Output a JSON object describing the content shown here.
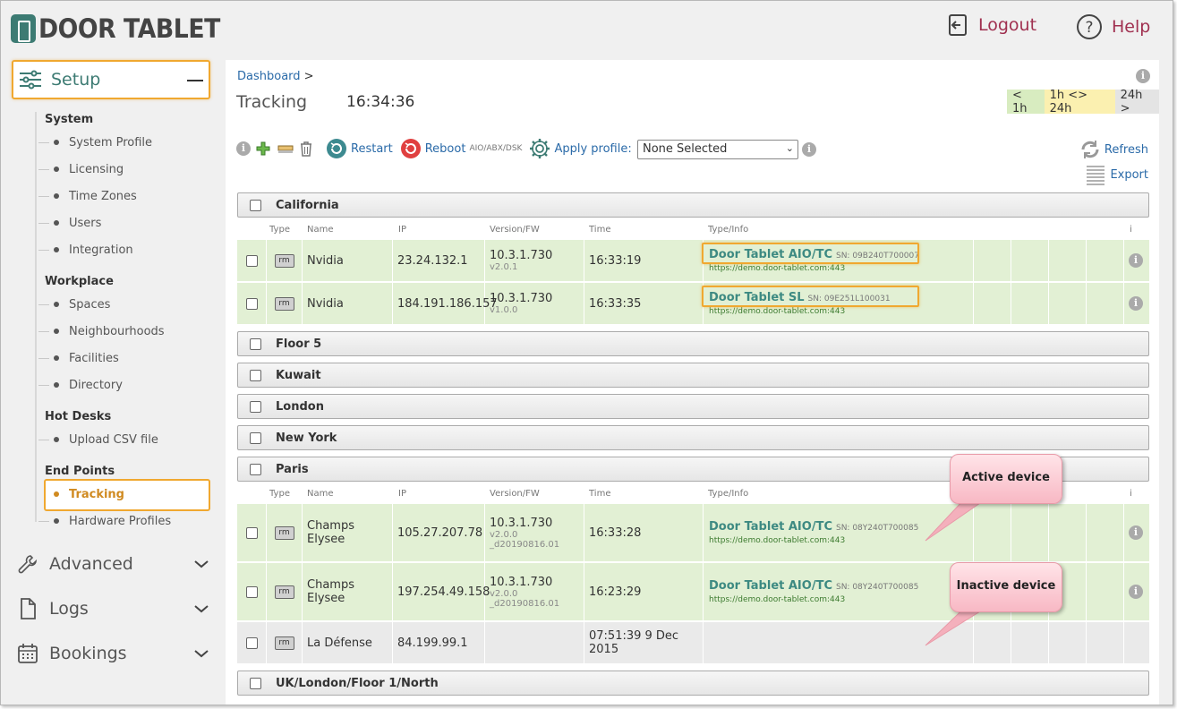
{
  "header": {
    "logo_text": "DOOR TABLET",
    "logout_label": "Logout",
    "help_label": "Help"
  },
  "sidebar": {
    "setup_label": "Setup",
    "sections": [
      {
        "title": "System",
        "items": [
          "System Profile",
          "Licensing",
          "Time Zones",
          "Users",
          "Integration"
        ]
      },
      {
        "title": "Workplace",
        "items": [
          "Spaces",
          "Neighbourhoods",
          "Facilities",
          "Directory"
        ]
      },
      {
        "title": "Hot Desks",
        "items": [
          "Upload CSV file"
        ]
      },
      {
        "title": "End Points",
        "items": [
          "Tracking",
          "Hardware Profiles"
        ]
      }
    ],
    "active_item": "Tracking",
    "collapsed": [
      {
        "label": "Advanced",
        "icon": "wrench-icon"
      },
      {
        "label": "Logs",
        "icon": "document-icon"
      },
      {
        "label": "Bookings",
        "icon": "calendar-icon"
      }
    ]
  },
  "main": {
    "breadcrumb": "Dashboard",
    "breadcrumb_sep": ">",
    "title": "Tracking",
    "clock": "16:34:36",
    "ranges": [
      {
        "label": "< 1h",
        "color": "#d8ecc0"
      },
      {
        "label": "1h <> 24h",
        "color": "#fbf0b0"
      },
      {
        "label": "24h >",
        "color": "#e4e4e4"
      }
    ],
    "toolbar": {
      "restart_label": "Restart",
      "reboot_label": "Reboot",
      "reboot_note": "AIO/ABX/DSK",
      "apply_profile_label": "Apply profile:",
      "profile_value": "None Selected",
      "refresh_label": "Refresh",
      "export_label": "Export"
    },
    "columns": [
      "Type",
      "Name",
      "IP",
      "Version/FW",
      "Time",
      "Type/Info",
      "i"
    ],
    "groups": [
      {
        "name": "California",
        "devices": [
          {
            "type": "rm",
            "name": "Nvidia",
            "ip": "23.24.132.1",
            "version": "10.3.1.730",
            "fw": "v2.0.1",
            "fw2": "",
            "time": "16:33:19",
            "device_type": "Door Tablet AIO/TC",
            "sn": "SN: 09B240T700007",
            "url": "https://demo.door-tablet.com:443",
            "status": "active"
          },
          {
            "type": "rm",
            "name": "Nvidia",
            "ip": "184.191.186.157",
            "version": "10.3.1.730",
            "fw": "v1.0.0",
            "fw2": "",
            "time": "16:33:35",
            "device_type": "Door Tablet SL",
            "sn": "SN: 09E251L100031",
            "url": "https://demo.door-tablet.com:443",
            "status": "active"
          }
        ]
      },
      {
        "name": "Floor 5",
        "devices": []
      },
      {
        "name": "Kuwait",
        "devices": []
      },
      {
        "name": "London",
        "devices": []
      },
      {
        "name": "New York",
        "devices": []
      },
      {
        "name": "Paris",
        "devices": [
          {
            "type": "rm",
            "name": "Champs Elysee",
            "ip": "105.27.207.78",
            "version": "10.3.1.730",
            "fw": "v2.0.0",
            "fw2": "_d20190816.01",
            "time": "16:33:28",
            "device_type": "Door Tablet AIO/TC",
            "sn": "SN: 08Y240T700085",
            "url": "https://demo.door-tablet.com:443",
            "status": "active"
          },
          {
            "type": "rm",
            "name": "Champs Elysee",
            "ip": "197.254.49.158",
            "version": "10.3.1.730",
            "fw": "v2.0.0",
            "fw2": "_d20190816.01",
            "time": "16:23:29",
            "device_type": "Door Tablet AIO/TC",
            "sn": "SN: 08Y240T700085",
            "url": "https://demo.door-tablet.com:443",
            "status": "active"
          },
          {
            "type": "rm",
            "name": "La Défense",
            "ip": "84.199.99.1",
            "version": "",
            "fw": "",
            "fw2": "",
            "time": "07:51:39 9 Dec 2015",
            "device_type": "",
            "sn": "",
            "url": "",
            "status": "inactive"
          }
        ]
      },
      {
        "name": "UK/London/Floor 1/North",
        "devices": []
      }
    ]
  },
  "callouts": {
    "active": "Active device",
    "inactive": "Inactive device"
  },
  "colors": {
    "accent": "#3d7b73",
    "link": "#2a6aa8",
    "highlight": "#f0a830",
    "active_row": "#e2f0d4",
    "inactive_row": "#eaeaea",
    "logout": "#a03050"
  }
}
